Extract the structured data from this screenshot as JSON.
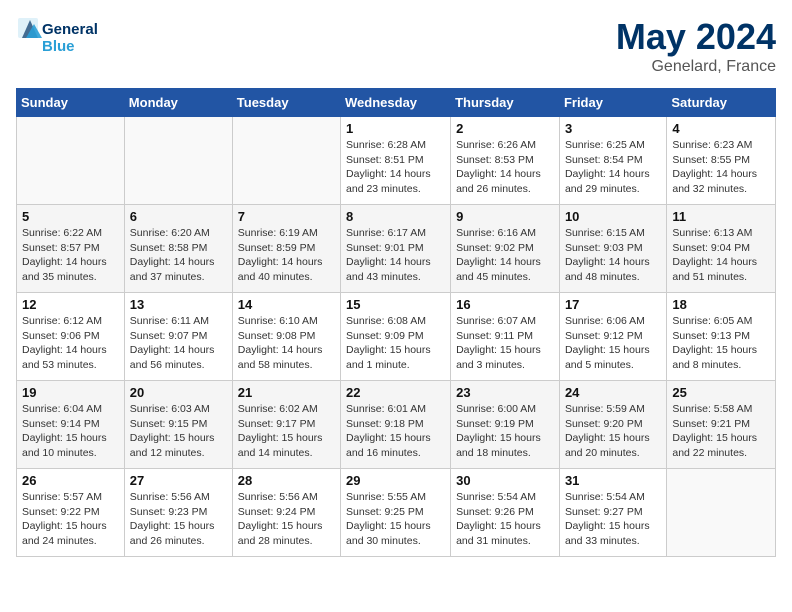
{
  "header": {
    "logo_line1": "General",
    "logo_line2": "Blue",
    "month": "May 2024",
    "location": "Genelard, France"
  },
  "weekdays": [
    "Sunday",
    "Monday",
    "Tuesday",
    "Wednesday",
    "Thursday",
    "Friday",
    "Saturday"
  ],
  "weeks": [
    [
      {
        "day": "",
        "info": ""
      },
      {
        "day": "",
        "info": ""
      },
      {
        "day": "",
        "info": ""
      },
      {
        "day": "1",
        "info": "Sunrise: 6:28 AM\nSunset: 8:51 PM\nDaylight: 14 hours\nand 23 minutes."
      },
      {
        "day": "2",
        "info": "Sunrise: 6:26 AM\nSunset: 8:53 PM\nDaylight: 14 hours\nand 26 minutes."
      },
      {
        "day": "3",
        "info": "Sunrise: 6:25 AM\nSunset: 8:54 PM\nDaylight: 14 hours\nand 29 minutes."
      },
      {
        "day": "4",
        "info": "Sunrise: 6:23 AM\nSunset: 8:55 PM\nDaylight: 14 hours\nand 32 minutes."
      }
    ],
    [
      {
        "day": "5",
        "info": "Sunrise: 6:22 AM\nSunset: 8:57 PM\nDaylight: 14 hours\nand 35 minutes."
      },
      {
        "day": "6",
        "info": "Sunrise: 6:20 AM\nSunset: 8:58 PM\nDaylight: 14 hours\nand 37 minutes."
      },
      {
        "day": "7",
        "info": "Sunrise: 6:19 AM\nSunset: 8:59 PM\nDaylight: 14 hours\nand 40 minutes."
      },
      {
        "day": "8",
        "info": "Sunrise: 6:17 AM\nSunset: 9:01 PM\nDaylight: 14 hours\nand 43 minutes."
      },
      {
        "day": "9",
        "info": "Sunrise: 6:16 AM\nSunset: 9:02 PM\nDaylight: 14 hours\nand 45 minutes."
      },
      {
        "day": "10",
        "info": "Sunrise: 6:15 AM\nSunset: 9:03 PM\nDaylight: 14 hours\nand 48 minutes."
      },
      {
        "day": "11",
        "info": "Sunrise: 6:13 AM\nSunset: 9:04 PM\nDaylight: 14 hours\nand 51 minutes."
      }
    ],
    [
      {
        "day": "12",
        "info": "Sunrise: 6:12 AM\nSunset: 9:06 PM\nDaylight: 14 hours\nand 53 minutes."
      },
      {
        "day": "13",
        "info": "Sunrise: 6:11 AM\nSunset: 9:07 PM\nDaylight: 14 hours\nand 56 minutes."
      },
      {
        "day": "14",
        "info": "Sunrise: 6:10 AM\nSunset: 9:08 PM\nDaylight: 14 hours\nand 58 minutes."
      },
      {
        "day": "15",
        "info": "Sunrise: 6:08 AM\nSunset: 9:09 PM\nDaylight: 15 hours\nand 1 minute."
      },
      {
        "day": "16",
        "info": "Sunrise: 6:07 AM\nSunset: 9:11 PM\nDaylight: 15 hours\nand 3 minutes."
      },
      {
        "day": "17",
        "info": "Sunrise: 6:06 AM\nSunset: 9:12 PM\nDaylight: 15 hours\nand 5 minutes."
      },
      {
        "day": "18",
        "info": "Sunrise: 6:05 AM\nSunset: 9:13 PM\nDaylight: 15 hours\nand 8 minutes."
      }
    ],
    [
      {
        "day": "19",
        "info": "Sunrise: 6:04 AM\nSunset: 9:14 PM\nDaylight: 15 hours\nand 10 minutes."
      },
      {
        "day": "20",
        "info": "Sunrise: 6:03 AM\nSunset: 9:15 PM\nDaylight: 15 hours\nand 12 minutes."
      },
      {
        "day": "21",
        "info": "Sunrise: 6:02 AM\nSunset: 9:17 PM\nDaylight: 15 hours\nand 14 minutes."
      },
      {
        "day": "22",
        "info": "Sunrise: 6:01 AM\nSunset: 9:18 PM\nDaylight: 15 hours\nand 16 minutes."
      },
      {
        "day": "23",
        "info": "Sunrise: 6:00 AM\nSunset: 9:19 PM\nDaylight: 15 hours\nand 18 minutes."
      },
      {
        "day": "24",
        "info": "Sunrise: 5:59 AM\nSunset: 9:20 PM\nDaylight: 15 hours\nand 20 minutes."
      },
      {
        "day": "25",
        "info": "Sunrise: 5:58 AM\nSunset: 9:21 PM\nDaylight: 15 hours\nand 22 minutes."
      }
    ],
    [
      {
        "day": "26",
        "info": "Sunrise: 5:57 AM\nSunset: 9:22 PM\nDaylight: 15 hours\nand 24 minutes."
      },
      {
        "day": "27",
        "info": "Sunrise: 5:56 AM\nSunset: 9:23 PM\nDaylight: 15 hours\nand 26 minutes."
      },
      {
        "day": "28",
        "info": "Sunrise: 5:56 AM\nSunset: 9:24 PM\nDaylight: 15 hours\nand 28 minutes."
      },
      {
        "day": "29",
        "info": "Sunrise: 5:55 AM\nSunset: 9:25 PM\nDaylight: 15 hours\nand 30 minutes."
      },
      {
        "day": "30",
        "info": "Sunrise: 5:54 AM\nSunset: 9:26 PM\nDaylight: 15 hours\nand 31 minutes."
      },
      {
        "day": "31",
        "info": "Sunrise: 5:54 AM\nSunset: 9:27 PM\nDaylight: 15 hours\nand 33 minutes."
      },
      {
        "day": "",
        "info": ""
      }
    ]
  ]
}
